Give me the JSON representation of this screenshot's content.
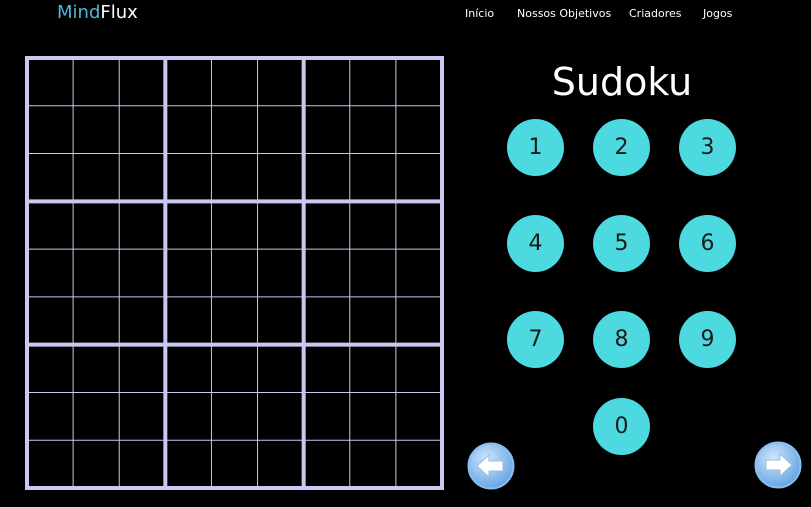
{
  "brand": {
    "part1": "Mind",
    "part2": "Flux"
  },
  "nav": [
    {
      "label": "Início"
    },
    {
      "label": "Nossos Objetivos"
    },
    {
      "label": "Criadores"
    },
    {
      "label": "Jogos"
    }
  ],
  "game": {
    "title": "Sudoku",
    "keypad": [
      "1",
      "2",
      "3",
      "4",
      "5",
      "6",
      "7",
      "8",
      "9",
      "0"
    ]
  },
  "icons": {
    "prev": "arrow-left-icon",
    "next": "arrow-right-icon"
  },
  "colors": {
    "background": "#000000",
    "brand_accent": "#4fb8d6",
    "keypad": "#4dd9e0",
    "grid": "#c8c8f0",
    "arrow_button": "#7ab4ee"
  }
}
